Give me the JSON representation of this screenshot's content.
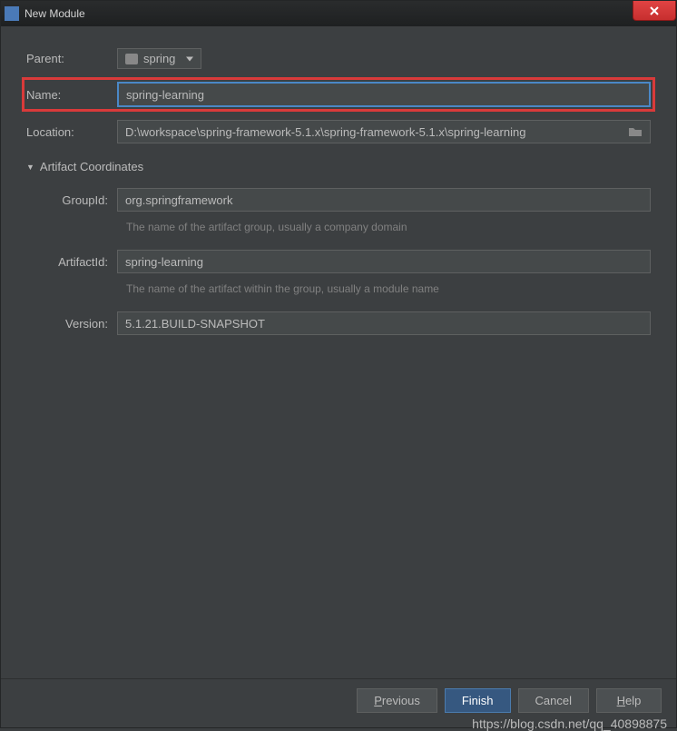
{
  "window": {
    "title": "New Module"
  },
  "form": {
    "parentLabel": "Parent:",
    "parentValue": "spring",
    "nameLabel": "Name:",
    "nameValue": "spring-learning",
    "locationLabel": "Location:",
    "locationValue": "D:\\workspace\\spring-framework-5.1.x\\spring-framework-5.1.x\\spring-learning"
  },
  "artifact": {
    "header": "Artifact Coordinates",
    "groupIdLabel": "GroupId:",
    "groupIdValue": "org.springframework",
    "groupIdHint": "The name of the artifact group, usually a company domain",
    "artifactIdLabel": "ArtifactId:",
    "artifactIdValue": "spring-learning",
    "artifactIdHint": "The name of the artifact within the group, usually a module name",
    "versionLabel": "Version:",
    "versionValue": "5.1.21.BUILD-SNAPSHOT"
  },
  "buttons": {
    "previous": "Previous",
    "finish": "Finish",
    "cancel": "Cancel",
    "help": "Help"
  },
  "watermark": "https://blog.csdn.net/qq_40898875"
}
